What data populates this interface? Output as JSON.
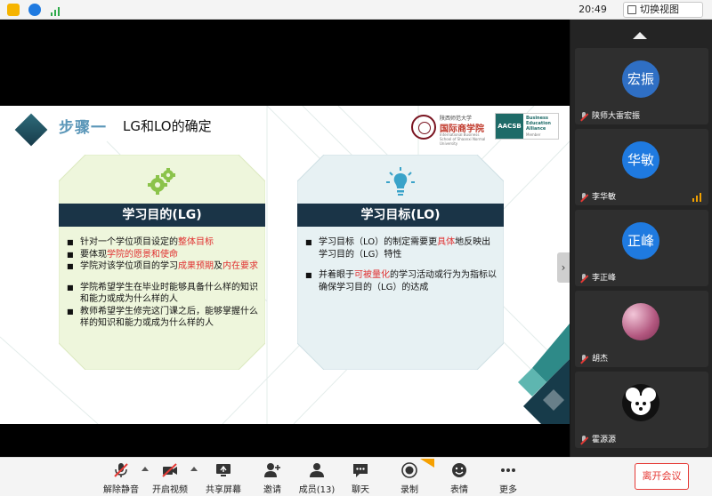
{
  "status_bar": {
    "time": "20:49",
    "switch_view_label": "切换视图"
  },
  "slide": {
    "step_label": "步骤一",
    "title": "LG和LO的确定",
    "logo_school": {
      "cn_name": "陕西师范大学",
      "school": "国际商学院",
      "en": "International Business School of Shaanxi Normal University"
    },
    "logo_aacsb": {
      "badge": "AACSB",
      "line1": "Business",
      "line2": "Education",
      "line3": "Alliance",
      "member": "Member"
    },
    "card_lg": {
      "header": "学习目的(LG)",
      "items": [
        {
          "parts": [
            {
              "t": "针对一个学位项目设定的",
              "red": false
            },
            {
              "t": "整体目标",
              "red": true
            }
          ]
        },
        {
          "parts": [
            {
              "t": "要体现",
              "red": false
            },
            {
              "t": "学院的愿景和使命",
              "red": true
            }
          ]
        },
        {
          "parts": [
            {
              "t": "学院对该学位项目的学习",
              "red": false
            },
            {
              "t": "成果预期",
              "red": true
            },
            {
              "t": "及",
              "red": false
            },
            {
              "t": "内在要求",
              "red": true
            }
          ]
        },
        {
          "parts": [
            {
              "t": "学院希望学生在毕业时能够具备什么样的知识和能力或成为什么样的人",
              "red": false
            }
          ]
        },
        {
          "parts": [
            {
              "t": "教师希望学生修完这门课之后，能够掌握什么样的知识和能力或成为什么样的人",
              "red": false
            }
          ]
        }
      ]
    },
    "card_lo": {
      "header": "学习目标(LO)",
      "items": [
        {
          "parts": [
            {
              "t": "学习目标（LO）的制定需要更",
              "red": false
            },
            {
              "t": "具体",
              "red": true
            },
            {
              "t": "地反映出学习目的（LG）特性",
              "red": false
            }
          ]
        },
        {
          "parts": [
            {
              "t": "并着眼于",
              "red": false
            },
            {
              "t": "可被量化",
              "red": true
            },
            {
              "t": "的学习活动或行为为指标以确保学习目的（LG）的达成",
              "red": false
            }
          ]
        }
      ]
    }
  },
  "participants": [
    {
      "avatar_text": "宏振",
      "name": "陕师大雷宏振",
      "avatar_color": "#2f6fc4",
      "signal": false
    },
    {
      "avatar_text": "华敏",
      "name": "李华敏",
      "avatar_color": "#1f7ae0",
      "signal": true
    },
    {
      "avatar_text": "正峰",
      "name": "李正峰",
      "avatar_color": "#1f7ae0",
      "signal": false
    },
    {
      "avatar_text": "",
      "name": "胡杰",
      "avatar_color": "#c77a9e",
      "signal": false
    },
    {
      "avatar_text": "",
      "name": "霍源源",
      "avatar_color": "#111111",
      "signal": false
    }
  ],
  "toolbar": {
    "mute": "解除静音",
    "video": "开启视频",
    "share": "共享屏幕",
    "invite": "邀请",
    "members": "成员(13)",
    "chat": "聊天",
    "record": "录制",
    "reactions": "表情",
    "more": "更多",
    "leave": "离开会议"
  },
  "colors": {
    "accent_blue": "#1f7ae0",
    "danger": "#e53935",
    "slide_navy": "#1a3447",
    "highlight_red": "#e03030"
  }
}
